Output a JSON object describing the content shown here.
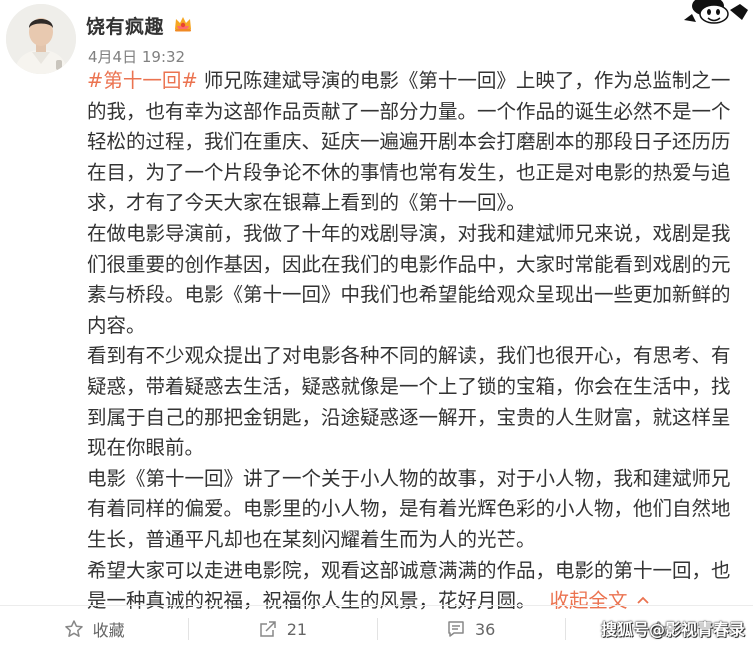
{
  "post": {
    "username": "饶有疯趣",
    "time": "4月4日 19:32",
    "topic_tag": "#第十一回#",
    "paragraphs": [
      "师兄陈建斌导演的电影《第十一回》上映了，作为总监制之一的我，也有幸为这部作品贡献了一部分力量。一个作品的诞生必然不是一个轻松的过程，我们在重庆、延庆一遍遍开剧本会打磨剧本的那段日子还历历在目，为了一个片段争论不休的事情也常有发生，也正是对电影的热爱与追求，才有了今天大家在银幕上看到的《第十一回》。",
      "在做电影导演前，我做了十年的戏剧导演，对我和建斌师兄来说，戏剧是我们很重要的创作基因，因此在我们的电影作品中，大家时常能看到戏剧的元素与桥段。电影《第十一回》中我们也希望能给观众呈现出一些更加新鲜的内容。",
      "看到有不少观众提出了对电影各种不同的解读，我们也很开心，有思考、有疑惑，带着疑惑去生活，疑惑就像是一个上了锁的宝箱，你会在生活中，找到属于自己的那把金钥匙，沿途疑惑逐一解开，宝贵的人生财富，就这样呈现在你眼前。",
      "电影《第十一回》讲了一个关于小人物的故事，对于小人物，我和建斌师兄有着同样的偏爱。电影里的小人物，是有着光辉色彩的小人物，他们自然地生长，普通平凡却也在某刻闪耀着生而为人的光芒。",
      "希望大家可以走进电影院，观看这部诚意满满的作品，电影的第十一回，也是一种真诚的祝福，祝福你人生的风景，花好月圆。"
    ],
    "collapse_label": "收起全文",
    "collapse_icon": "chevron-up-icon"
  },
  "actions": {
    "favorite_label": "收藏",
    "repost_count": "21",
    "comment_count": "36"
  },
  "watermark": "搜狐号@影视青春录",
  "colors": {
    "accent": "#eb7350",
    "text": "#333333",
    "meta": "#808080"
  }
}
